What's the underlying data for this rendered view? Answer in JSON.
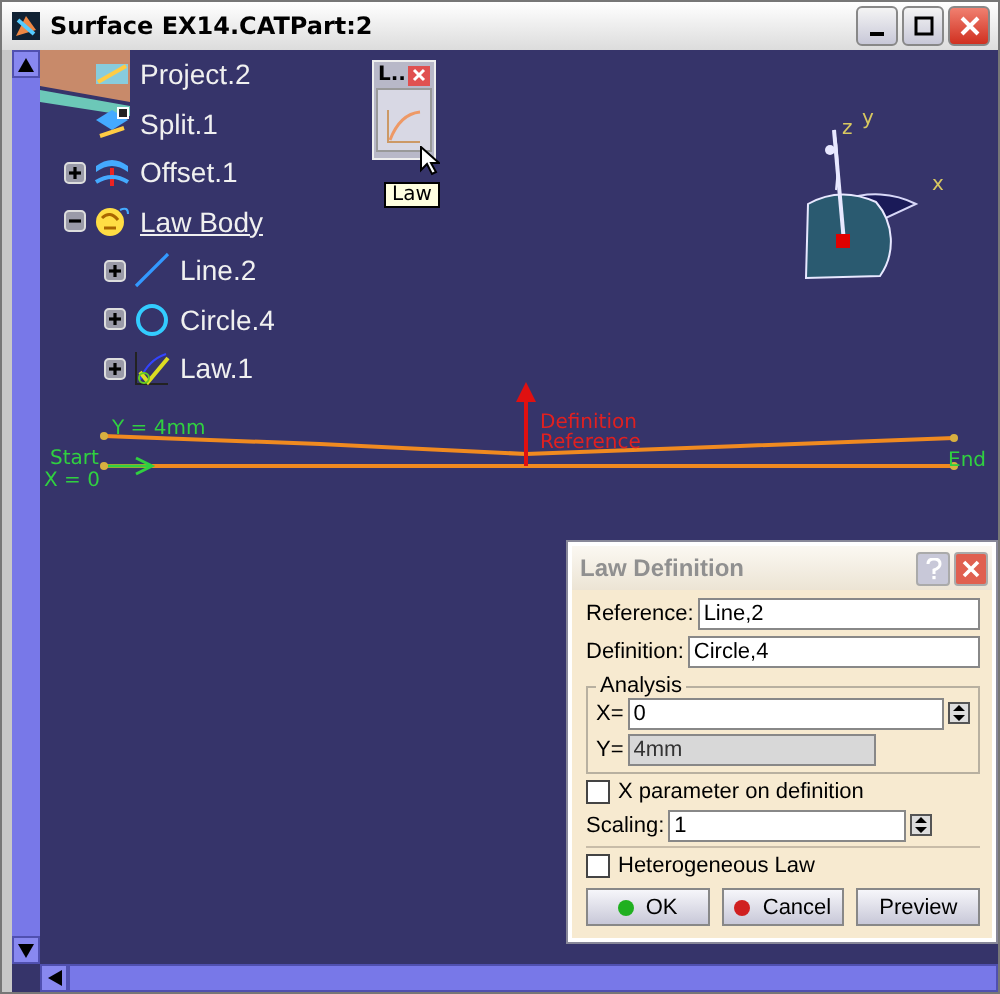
{
  "window": {
    "title": "Surface EX14.CATPart:2"
  },
  "tree": [
    {
      "label": "Project.2",
      "kind": "project"
    },
    {
      "label": "Split.1",
      "kind": "split"
    },
    {
      "label": "Offset.1",
      "kind": "offset",
      "expanded": false
    },
    {
      "label": "Law Body",
      "kind": "body",
      "expanded": true,
      "active": true,
      "children": [
        {
          "label": "Line.2",
          "kind": "line",
          "expanded": false
        },
        {
          "label": "Circle.4",
          "kind": "circle",
          "expanded": false
        },
        {
          "label": "Law.1",
          "kind": "law",
          "expanded": false
        }
      ]
    }
  ],
  "toolbar": {
    "title": "L..",
    "tooltip": "Law"
  },
  "viewport": {
    "definition": "Definition",
    "reference": "Reference",
    "start": "Start",
    "x_value": "X = 0",
    "y_value": "Y = 4mm",
    "end": "End",
    "compass": {
      "x": "x",
      "y": "y",
      "z": "z"
    }
  },
  "dialog": {
    "title": "Law Definition",
    "reference": {
      "label": "Reference:",
      "value": "Line,2"
    },
    "definition": {
      "label": "Definition:",
      "value": "Circle,4"
    },
    "analysis": {
      "title": "Analysis",
      "x": {
        "label": "X=",
        "value": "0"
      },
      "y": {
        "label": "Y=",
        "value": "4mm",
        "disabled": true
      }
    },
    "x_param": {
      "label": "X parameter on definition",
      "checked": false
    },
    "scaling": {
      "label": "Scaling:",
      "value": "1"
    },
    "heterogeneous": {
      "label": "Heterogeneous Law",
      "checked": false
    },
    "buttons": [
      {
        "label": "OK",
        "kind": "ok"
      },
      {
        "label": "Cancel",
        "kind": "cancel"
      },
      {
        "label": "Preview",
        "kind": "plain"
      }
    ]
  }
}
